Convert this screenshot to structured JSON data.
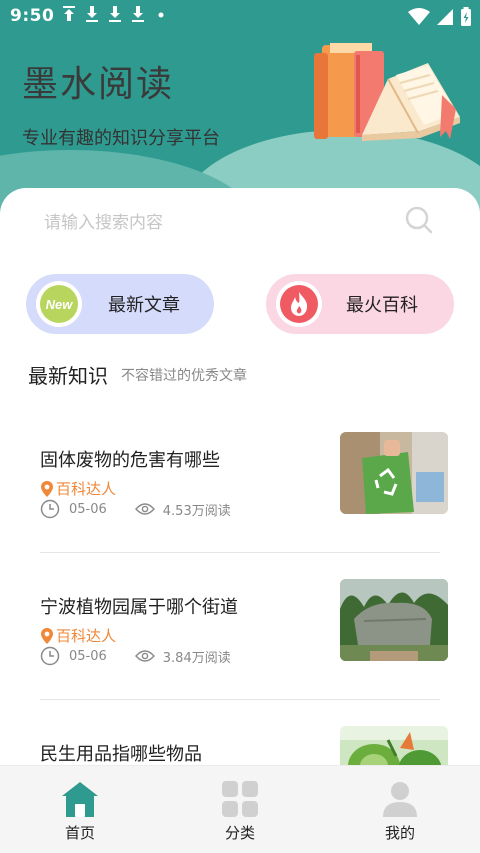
{
  "status_bar": {
    "time": "9:50"
  },
  "header": {
    "title": "墨水阅读",
    "subtitle": "专业有趣的知识分享平台"
  },
  "search": {
    "placeholder": "请输入搜索内容"
  },
  "quick_actions": [
    {
      "label": "最新文章",
      "icon": "new-badge-icon",
      "icon_text": "New",
      "color": "#d5dcfb"
    },
    {
      "label": "最火百科",
      "icon": "flame-icon",
      "color": "#fbd6e3"
    }
  ],
  "section": {
    "title": "最新知识",
    "subtitle": "不容错过的优秀文章"
  },
  "articles": [
    {
      "title": "固体废物的危害有哪些",
      "author": "百科达人",
      "date": "05-06",
      "views": "4.53万阅读",
      "thumb": "recycling-bag-photo"
    },
    {
      "title": "宁波植物园属于哪个街道",
      "author": "百科达人",
      "date": "05-06",
      "views": "3.84万阅读",
      "thumb": "botanical-garden-stone-photo"
    },
    {
      "title": "民生用品指哪些物品",
      "thumb": "vegetables-photo"
    }
  ],
  "bottom_nav": [
    {
      "label": "首页",
      "icon": "home-icon",
      "active": true
    },
    {
      "label": "分类",
      "icon": "category-grid-icon",
      "active": false
    },
    {
      "label": "我的",
      "icon": "user-icon",
      "active": false
    }
  ],
  "colors": {
    "brand": "#2f9b90",
    "author": "#f0883a",
    "nav_active": "#2f9b90",
    "nav_inactive": "#d0d0d0"
  }
}
